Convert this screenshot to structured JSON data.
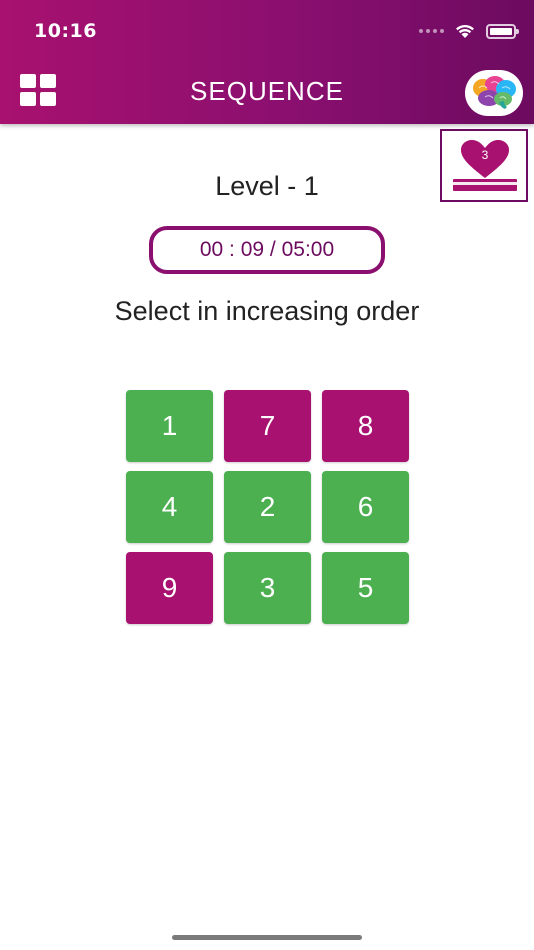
{
  "status_bar": {
    "time": "10:16"
  },
  "header": {
    "title": "SEQUENCE",
    "background_from": "#a8116f",
    "background_to": "#6c0b60",
    "menu_icon": "grid-menu-icon",
    "brain_icon": "brain-icon"
  },
  "lives": {
    "count": "3",
    "icon": "heart-icon"
  },
  "level": {
    "title": "Level - 1"
  },
  "timer": {
    "text": "00 : 09 / 05:00"
  },
  "instruction": "Select in increasing order",
  "tiles": [
    {
      "value": "1",
      "color": "green"
    },
    {
      "value": "7",
      "color": "magenta"
    },
    {
      "value": "8",
      "color": "magenta"
    },
    {
      "value": "4",
      "color": "green"
    },
    {
      "value": "2",
      "color": "green"
    },
    {
      "value": "6",
      "color": "green"
    },
    {
      "value": "9",
      "color": "magenta"
    },
    {
      "value": "3",
      "color": "green"
    },
    {
      "value": "5",
      "color": "green"
    }
  ],
  "colors": {
    "green": "#4caf50",
    "magenta": "#a8116f"
  }
}
